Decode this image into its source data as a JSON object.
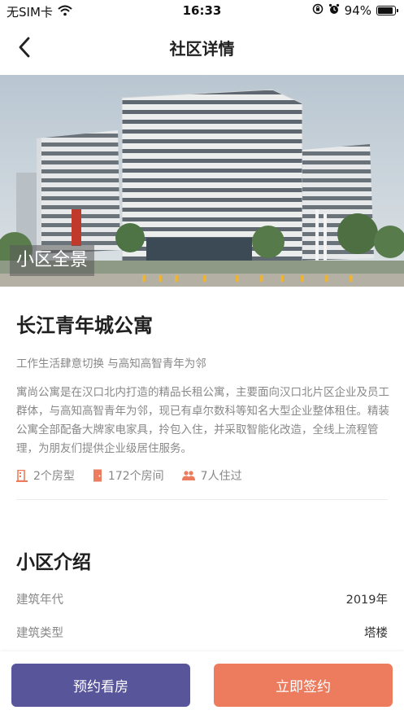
{
  "status_bar": {
    "carrier": "无SIM卡",
    "time": "16:33",
    "battery": "94%",
    "battery_level": 0.94
  },
  "nav": {
    "title": "社区详情"
  },
  "hero": {
    "caption": "小区全景"
  },
  "community": {
    "name": "长江青年城公寓",
    "tagline": "工作生活肆意切换 与高知高智青年为邻",
    "description": "寓尚公寓是在汉口北内打造的精品长租公寓，主要面向汉口北片区企业及员工群体，与高知高智青年为邻，现已有卓尔数科等知名大型企业整体租住。精装公寓全部配备大牌家电家具，拎包入住，并采取智能化改造，全线上流程管理，为朋友们提供企业级居住服务。",
    "stats": [
      {
        "icon": "building-icon",
        "text": "2个房型"
      },
      {
        "icon": "door-icon",
        "text": "172个房间"
      },
      {
        "icon": "people-icon",
        "text": "7人住过"
      }
    ]
  },
  "intro": {
    "title": "小区介绍",
    "rows": [
      {
        "label": "建筑年代",
        "value": "2019年"
      },
      {
        "label": "建筑类型",
        "value": "塔楼"
      }
    ]
  },
  "actions": {
    "view_label": "预约看房",
    "sign_label": "立即签约"
  },
  "colors": {
    "primary_purple": "#58559a",
    "accent_orange": "#ed7c5f",
    "icon_orange": "#ed7c5f"
  }
}
